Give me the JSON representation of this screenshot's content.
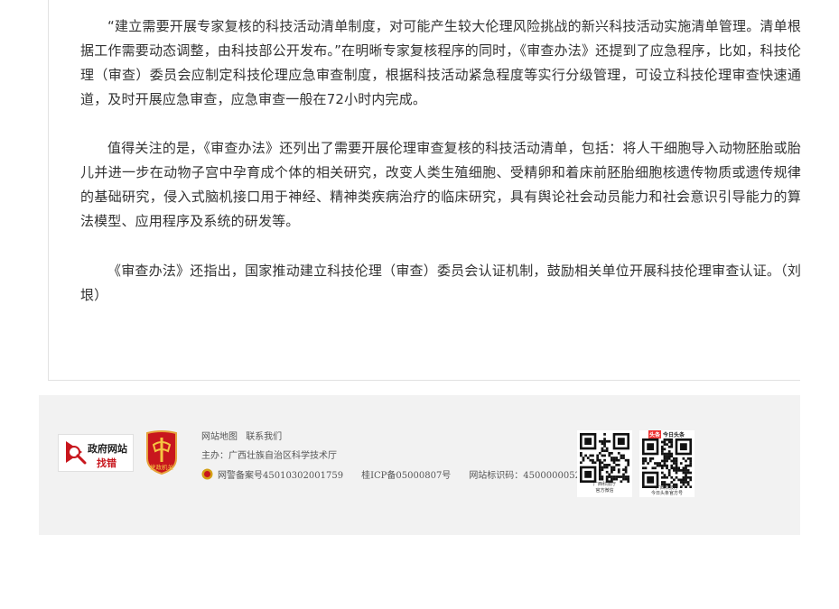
{
  "article": {
    "paragraphs": [
      "“建立需要开展专家复核的科技活动清单制度，对可能产生较大伦理风险挑战的新兴科技活动实施清单管理。清单根据工作需要动态调整，由科技部公开发布。”在明晰专家复核程序的同时，《审查办法》还提到了应急程序，比如，科技伦理（审查）委员会应制定科技伦理应急审查制度，根据科技活动紧急程度等实行分级管理，可设立科技伦理审查快速通道，及时开展应急审查，应急审查一般在72小时内完成。",
      "值得关注的是，《审查办法》还列出了需要开展伦理审查复核的科技活动清单，包括：将人干细胞导入动物胚胎或胎儿并进一步在动物子宫中孕育成个体的相关研究，改变人类生殖细胞、受精卵和着床前胚胎细胞核遗传物质或遗传规律的基础研究，侵入式脑机接口用于神经、精神类疾病治疗的临床研究，具有舆论社会动员能力和社会意识引导能力的算法模型、应用程序及系统的研发等。",
      "《审查办法》还指出，国家推动建立科技伦理（审查）委员会认证机制，鼓励相关单位开展科技伦理审查认证。（刘垠）"
    ]
  },
  "footer": {
    "find_error": {
      "line1": "政府网站",
      "line2": "找错"
    },
    "party_badge_label": "党政机关",
    "links": [
      "网站地图",
      "联系我们"
    ],
    "host": "主办：广西壮族自治区科学技术厅",
    "police_record": "网警备案号45010302001759",
    "icp": "桂ICP备05000807号",
    "site_id": "网站标识码：4500000052",
    "qr1_caption": [
      "广西科技厅",
      "官方微信"
    ],
    "qr2_header": "今日头条",
    "qr2_mark": "头条",
    "qr2_caption": [
      "广西科技厅",
      "今日头条官方号"
    ]
  },
  "colors": {
    "accent_red": "#c8161d",
    "footer_bg": "#f2f2f2",
    "text": "#333333"
  }
}
